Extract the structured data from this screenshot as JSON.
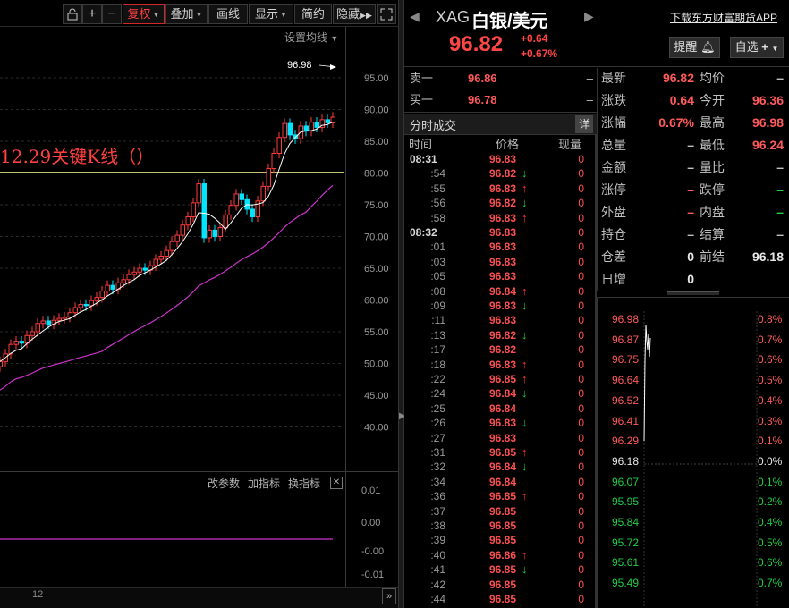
{
  "toolbar": {
    "buttons": [
      "复权",
      "叠加",
      "画线",
      "显示",
      "简约",
      "隐藏"
    ],
    "settings_ma": "设置均线"
  },
  "main_chart": {
    "price_axis": [
      "95.00",
      "90.00",
      "85.00",
      "80.00",
      "75.00",
      "70.00",
      "65.00",
      "60.00",
      "55.00",
      "50.00",
      "45.00",
      "40.00"
    ],
    "high_marker": "96.98",
    "annotation": "12.29关键K线（）"
  },
  "indicator": {
    "buttons": [
      "改参数",
      "加指标",
      "换指标"
    ],
    "axis": [
      "0.01",
      "0.00",
      "-0.00",
      "-0.01"
    ]
  },
  "bottom": {
    "x_label": "12"
  },
  "quote": {
    "code": "XAG",
    "name": "白银/美元",
    "last": "96.82",
    "chg_abs": "+0.64",
    "chg_pct": "+0.67%",
    "download_link": "下载东方财富期货APP",
    "remind_btn": "提醒",
    "watchlist_btn": "自选"
  },
  "bidask": {
    "ask_label": "卖一",
    "ask_price": "96.86",
    "ask_dash": "–",
    "bid_label": "买一",
    "bid_price": "96.78",
    "bid_dash": "–"
  },
  "ticks": {
    "title": "分时成交",
    "detail_btn": "详",
    "header": [
      "时间",
      "价格",
      "现量"
    ],
    "rows": [
      {
        "t": "08:31",
        "p": "96.83",
        "d": "",
        "v": "0"
      },
      {
        "t": ":54",
        "p": "96.82",
        "d": "dn",
        "v": "0"
      },
      {
        "t": ":55",
        "p": "96.83",
        "d": "up",
        "v": "0"
      },
      {
        "t": ":56",
        "p": "96.82",
        "d": "dn",
        "v": "0"
      },
      {
        "t": ":58",
        "p": "96.83",
        "d": "up",
        "v": "0"
      },
      {
        "t": "08:32",
        "p": "96.83",
        "d": "",
        "v": "0"
      },
      {
        "t": ":01",
        "p": "96.83",
        "d": "",
        "v": "0"
      },
      {
        "t": ":03",
        "p": "96.83",
        "d": "",
        "v": "0"
      },
      {
        "t": ":05",
        "p": "96.83",
        "d": "",
        "v": "0"
      },
      {
        "t": ":08",
        "p": "96.84",
        "d": "up",
        "v": "0"
      },
      {
        "t": ":09",
        "p": "96.83",
        "d": "dn",
        "v": "0"
      },
      {
        "t": ":11",
        "p": "96.83",
        "d": "",
        "v": "0"
      },
      {
        "t": ":13",
        "p": "96.82",
        "d": "dn",
        "v": "0"
      },
      {
        "t": ":17",
        "p": "96.82",
        "d": "",
        "v": "0"
      },
      {
        "t": ":18",
        "p": "96.83",
        "d": "up",
        "v": "0"
      },
      {
        "t": ":22",
        "p": "96.85",
        "d": "up",
        "v": "0"
      },
      {
        "t": ":24",
        "p": "96.84",
        "d": "dn",
        "v": "0"
      },
      {
        "t": ":25",
        "p": "96.84",
        "d": "",
        "v": "0"
      },
      {
        "t": ":26",
        "p": "96.83",
        "d": "dn",
        "v": "0"
      },
      {
        "t": ":27",
        "p": "96.83",
        "d": "",
        "v": "0"
      },
      {
        "t": ":31",
        "p": "96.85",
        "d": "up",
        "v": "0"
      },
      {
        "t": ":32",
        "p": "96.84",
        "d": "dn",
        "v": "0"
      },
      {
        "t": ":34",
        "p": "96.84",
        "d": "",
        "v": "0"
      },
      {
        "t": ":36",
        "p": "96.85",
        "d": "up",
        "v": "0"
      },
      {
        "t": ":37",
        "p": "96.85",
        "d": "",
        "v": "0"
      },
      {
        "t": ":38",
        "p": "96.85",
        "d": "",
        "v": "0"
      },
      {
        "t": ":39",
        "p": "96.85",
        "d": "",
        "v": "0"
      },
      {
        "t": ":40",
        "p": "96.86",
        "d": "up",
        "v": "0"
      },
      {
        "t": ":41",
        "p": "96.85",
        "d": "dn",
        "v": "0"
      },
      {
        "t": ":42",
        "p": "96.85",
        "d": "",
        "v": "0"
      },
      {
        "t": ":44",
        "p": "96.85",
        "d": "",
        "v": "0"
      }
    ]
  },
  "stats": [
    {
      "l1": "最新",
      "v1": "96.82",
      "c1": "red",
      "l2": "均价",
      "v2": "–",
      "c2": "grey"
    },
    {
      "l1": "涨跌",
      "v1": "0.64",
      "c1": "red",
      "l2": "今开",
      "v2": "96.36",
      "c2": "red"
    },
    {
      "l1": "涨幅",
      "v1": "0.67%",
      "c1": "red",
      "l2": "最高",
      "v2": "96.98",
      "c2": "red"
    },
    {
      "l1": "总量",
      "v1": "–",
      "c1": "grey",
      "l2": "最低",
      "v2": "96.24",
      "c2": "red"
    },
    {
      "l1": "金额",
      "v1": "–",
      "c1": "grey",
      "l2": "量比",
      "v2": "–",
      "c2": "grey"
    },
    {
      "l1": "涨停",
      "v1": "–",
      "c1": "red",
      "l2": "跌停",
      "v2": "–",
      "c2": "green"
    },
    {
      "l1": "外盘",
      "v1": "–",
      "c1": "red",
      "l2": "内盘",
      "v2": "–",
      "c2": "green"
    },
    {
      "l1": "持仓",
      "v1": "–",
      "c1": "grey",
      "l2": "结算",
      "v2": "–",
      "c2": "grey"
    },
    {
      "l1": "仓差",
      "v1": "0",
      "c1": "white",
      "l2": "前结",
      "v2": "96.18",
      "c2": "white"
    },
    {
      "l1": "日增",
      "v1": "0",
      "c1": "white",
      "l2": "",
      "v2": "",
      "c2": "grey"
    }
  ],
  "mini": {
    "prices": [
      "96.98",
      "96.87",
      "96.75",
      "96.64",
      "96.52",
      "96.41",
      "96.29",
      "96.18",
      "96.07",
      "95.95",
      "95.84",
      "95.72",
      "95.61",
      "95.49"
    ],
    "pcts": [
      "0.8%",
      "0.7%",
      "0.6%",
      "0.5%",
      "0.4%",
      "0.3%",
      "0.1%",
      "0.0%",
      "0.1%",
      "0.2%",
      "0.4%",
      "0.5%",
      "0.6%",
      "0.7%"
    ]
  },
  "colors": {
    "up": "#ff3a3a",
    "down": "#22cc44",
    "candle_down": "#00e5ff",
    "ma_fast": "#ffffff",
    "ma_slow": "#cc33cc",
    "annotation": "#ff4040",
    "key_line": "#ffff99"
  }
}
